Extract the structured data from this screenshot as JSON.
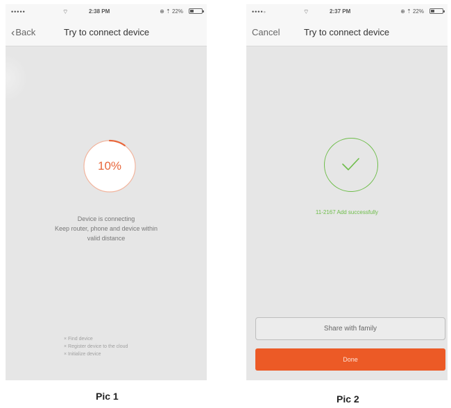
{
  "pic1": {
    "status": {
      "signal": "•••••",
      "wifi": "⌔",
      "time": "2:38 PM",
      "battery": "⊕ ⇡ 22%"
    },
    "nav": {
      "back_label": "Back",
      "title": "Try to connect device"
    },
    "progress": {
      "label": "10%",
      "value": 0.1
    },
    "message": [
      "Device is connecting",
      "Keep router, phone and device within",
      "valid distance"
    ],
    "steps": [
      "× Find device",
      "× Register device to the cloud",
      "× Initialize device"
    ],
    "colors": {
      "accent": "#e8663a"
    }
  },
  "pic2": {
    "status": {
      "signal": "••••◦",
      "wifi": "⌔",
      "time": "2:37 PM",
      "battery": "⊕ ⇡ 22%"
    },
    "nav": {
      "cancel_label": "Cancel",
      "title": "Try to connect device"
    },
    "success_text": "11-2167 Add successfully",
    "share_button": "Share with family",
    "done_button": "Done",
    "colors": {
      "success": "#6ebd4a",
      "primary": "#ec5a26"
    }
  },
  "captions": {
    "pic1": "Pic 1",
    "pic2": "Pic 2"
  }
}
